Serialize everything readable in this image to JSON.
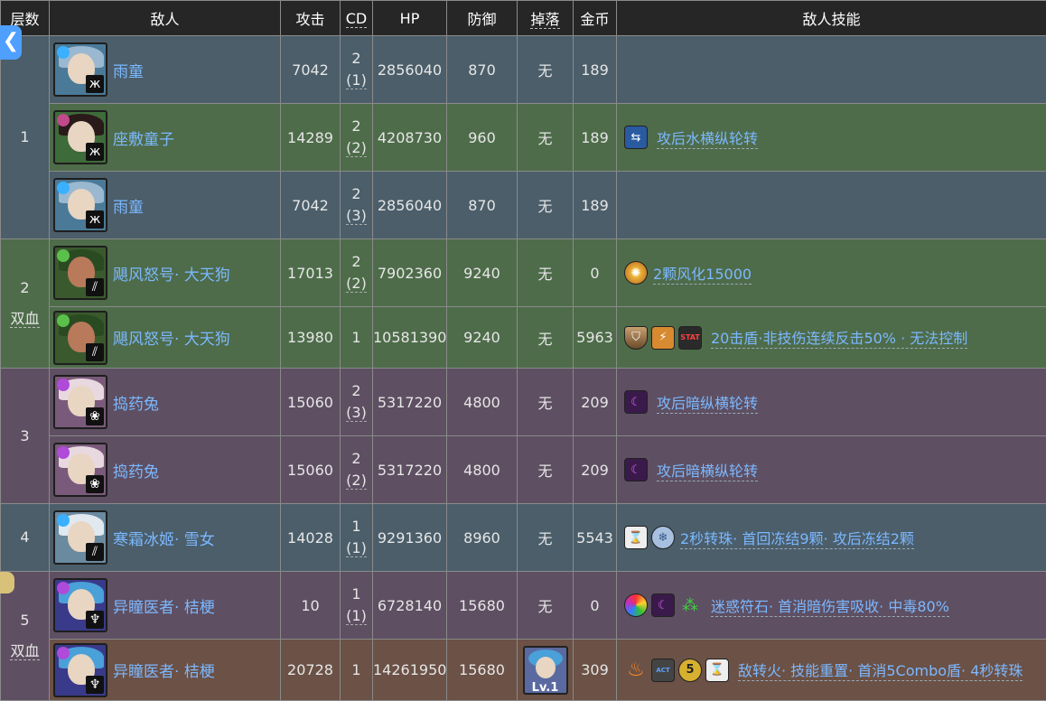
{
  "headers": {
    "floor": "层数",
    "enemy": "敌人",
    "attack": "攻击",
    "cd": "CD",
    "hp": "HP",
    "defense": "防御",
    "drop": "掉落",
    "coin": "金币",
    "skills": "敌人技能"
  },
  "nav": {
    "back_label": "❮"
  },
  "floors": [
    {
      "label": "1",
      "extra": ""
    },
    {
      "label": "2",
      "extra": "双血"
    },
    {
      "label": "3",
      "extra": ""
    },
    {
      "label": "4",
      "extra": ""
    },
    {
      "label": "5",
      "extra": "双血"
    }
  ],
  "rows": [
    {
      "name": "雨童",
      "attack": "7042",
      "cd": "2",
      "cd_sub": "(1)",
      "hp": "2856040",
      "defense": "870",
      "drop": "无",
      "coin": "189",
      "skills": ""
    },
    {
      "name": "座敷童子",
      "attack": "14289",
      "cd": "2",
      "cd_sub": "(2)",
      "hp": "4208730",
      "defense": "960",
      "drop": "无",
      "coin": "189",
      "skills": "攻后水横纵轮转"
    },
    {
      "name": "雨童",
      "attack": "7042",
      "cd": "2",
      "cd_sub": "(3)",
      "hp": "2856040",
      "defense": "870",
      "drop": "无",
      "coin": "189",
      "skills": ""
    },
    {
      "name": "飓风怒号· 大天狗",
      "attack": "17013",
      "cd": "2",
      "cd_sub": "(2)",
      "hp": "7902360",
      "defense": "9240",
      "drop": "无",
      "coin": "0",
      "skills": "2颗风化15000"
    },
    {
      "name": "飓风怒号· 大天狗",
      "attack": "13980",
      "cd": "1",
      "cd_sub": "",
      "hp": "10581390",
      "defense": "9240",
      "drop": "无",
      "coin": "5963",
      "skills": "20击盾·非技伤连续反击50% · 无法控制"
    },
    {
      "name": "捣药兔",
      "attack": "15060",
      "cd": "2",
      "cd_sub": "(3)",
      "hp": "5317220",
      "defense": "4800",
      "drop": "无",
      "coin": "209",
      "skills": "攻后暗纵横轮转"
    },
    {
      "name": "捣药兔",
      "attack": "15060",
      "cd": "2",
      "cd_sub": "(2)",
      "hp": "5317220",
      "defense": "4800",
      "drop": "无",
      "coin": "209",
      "skills": "攻后暗横纵轮转"
    },
    {
      "name": "寒霜冰姬· 雪女",
      "attack": "14028",
      "cd": "1",
      "cd_sub": "(1)",
      "hp": "9291360",
      "defense": "8960",
      "drop": "无",
      "coin": "5543",
      "skills": "2秒转珠· 首回冻结9颗· 攻后冻结2颗"
    },
    {
      "name": "异瞳医者· 桔梗",
      "attack": "10",
      "cd": "1",
      "cd_sub": "(1)",
      "hp": "6728140",
      "defense": "15680",
      "drop": "无",
      "coin": "0",
      "skills": "迷惑符石· 首消暗伤害吸收· 中毒80%"
    },
    {
      "name": "异瞳医者· 桔梗",
      "attack": "20728",
      "cd": "1",
      "cd_sub": "",
      "hp": "14261950",
      "defense": "15680",
      "drop": "Lv.1",
      "coin": "309",
      "skills": "敌转火· 技能重置· 首消5Combo盾· 4秒转珠"
    }
  ],
  "skill_icon_labels": {
    "stat": "STAT",
    "act": "ACT",
    "five": "5"
  },
  "colors": {
    "link": "#7cb8ff",
    "row_blue": "#4b5e6a",
    "row_green": "#4e6c4a",
    "row_purple": "#5e4f62",
    "row_brown": "#6b5146",
    "header": "#262626"
  }
}
